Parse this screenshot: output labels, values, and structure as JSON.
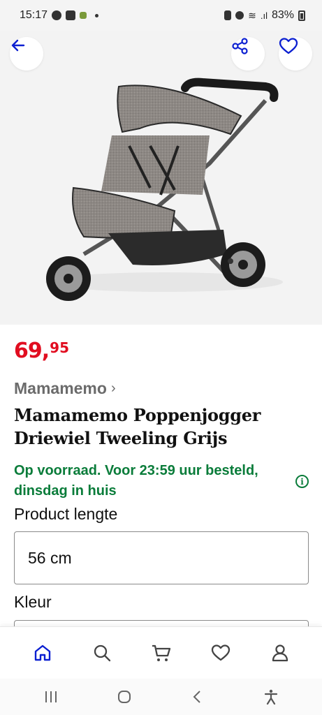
{
  "status_bar": {
    "time": "15:17",
    "battery": "83%"
  },
  "product": {
    "price_euros": "69,",
    "price_cents": "95",
    "brand": "Mamamemo",
    "brand_chevron": "›",
    "title": "Mamamemo Poppenjogger Driewiel Tweeling Grijs",
    "stock_message": "Op voorraad. Voor 23:59 uur besteld, dinsdag in huis",
    "info_icon_glyph": "i"
  },
  "options": {
    "length_label": "Product lengte",
    "length_value": "56 cm",
    "colour_label": "Kleur"
  },
  "icons": {
    "back": "back-arrow-icon",
    "share": "share-icon",
    "favorite": "heart-icon",
    "home": "home-icon",
    "search": "search-icon",
    "cart": "cart-icon",
    "wishlist": "heart-icon",
    "account": "user-icon"
  },
  "colors": {
    "accent_blue": "#0b1fd1",
    "price_red": "#e10d20",
    "stock_green": "#0a7c3a"
  }
}
